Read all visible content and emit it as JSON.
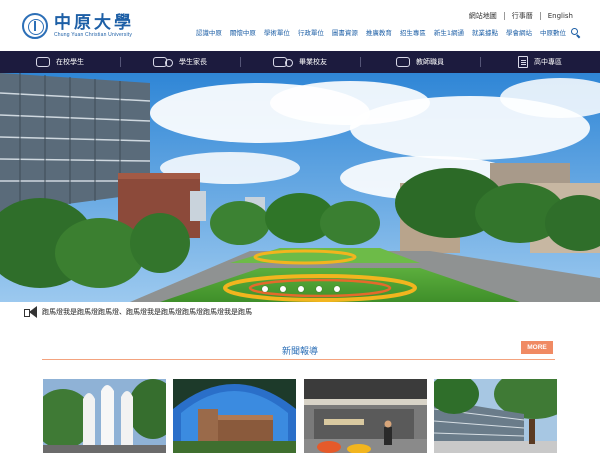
{
  "brand": {
    "name_cn": "中原大學",
    "name_en": "Chung Yuan Christian University",
    "logo": "seal-logo"
  },
  "utility_links": [
    "網站地圖",
    "行事曆",
    "English"
  ],
  "main_nav": [
    "認識中原",
    "關懷中原",
    "學術單位",
    "行政單位",
    "圖書資源",
    "推廣教育",
    "招生專區",
    "新生1網通",
    "就業據點",
    "學會網站",
    "中原數位"
  ],
  "audience_tabs": [
    {
      "label": "在校學生",
      "icon": "student-icon"
    },
    {
      "label": "學生家長",
      "icon": "parents-icon"
    },
    {
      "label": "畢業校友",
      "icon": "alumni-icon"
    },
    {
      "label": "教師職員",
      "icon": "staff-icon"
    },
    {
      "label": "高中專區",
      "icon": "highschool-icon"
    }
  ],
  "hero": {
    "slide_count": 5,
    "active_slide": 1
  },
  "ticker": {
    "text": "跑馬燈我是跑馬燈跑馬燈、跑馬燈我是跑馬燈跑馬燈跑馬燈我是跑馬"
  },
  "news": {
    "title": "新聞報導",
    "more_label": "MORE"
  },
  "colors": {
    "brand_blue": "#1d5fa6",
    "nav_bar": "#1c1b3e",
    "accent_orange": "#f08a63"
  }
}
